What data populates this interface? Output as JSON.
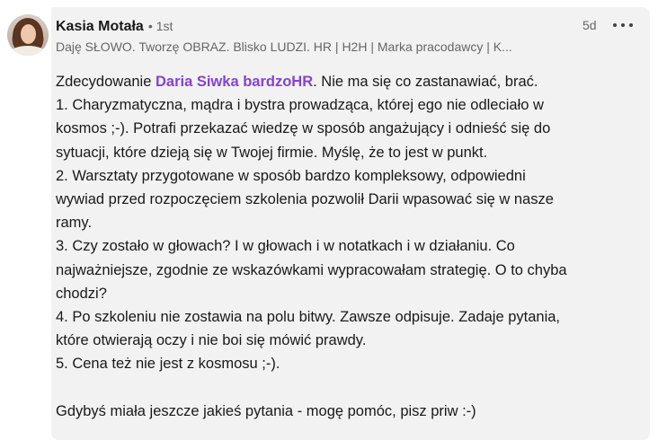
{
  "author": {
    "name": "Kasia Motała",
    "separator": "•",
    "degree": "1st",
    "headline": "Daję SŁOWO. Tworzę OBRAZ. Blisko LUDZI. HR | H2H | Marka pracodawcy | K...",
    "timestamp": "5d"
  },
  "menu": {
    "icon": "more-horizontal-icon"
  },
  "comment": {
    "intro_before": "Zdecydowanie ",
    "mention": "Daria Siwka bardzoHR",
    "intro_after": ". Nie ma się co zastanawiać, brać.",
    "lines": [
      "1. Charyzmatyczna, mądra i bystra prowadząca, której ego nie odleciało w",
      "kosmos ;-). Potrafi przekazać wiedzę w sposób angażujący i odnieść się do",
      "sytuacji, które dzieją się w Twojej firmie. Myślę, że to jest w punkt.",
      "2. Warsztaty przygotowane w sposób bardzo kompleksowy, odpowiedni",
      "wywiad przed rozpoczęciem szkolenia pozwolił Darii wpasować się w nasze",
      "ramy.",
      "3. Czy zostało w głowach? I w głowach i w notatkach i w działaniu. Co",
      "najważniejsze, zgodnie ze wskazówkami wypracowałam strategię. O to chyba",
      "chodzi?",
      "4. Po szkoleniu nie zostawia na polu bitwy. Zawsze odpisuje. Zadaje pytania,",
      "które otwierają oczy i nie boi się mówić prawdy.",
      "5. Cena też nie jest z kosmosu ;-)."
    ],
    "closing": "Gdybyś miała jeszcze jakieś pytania - mogę pomóc, pisz priw :-)"
  },
  "colors": {
    "bubble_background": "#f2f2f2",
    "mention": "#8344cc",
    "secondary_text": "#666666"
  }
}
